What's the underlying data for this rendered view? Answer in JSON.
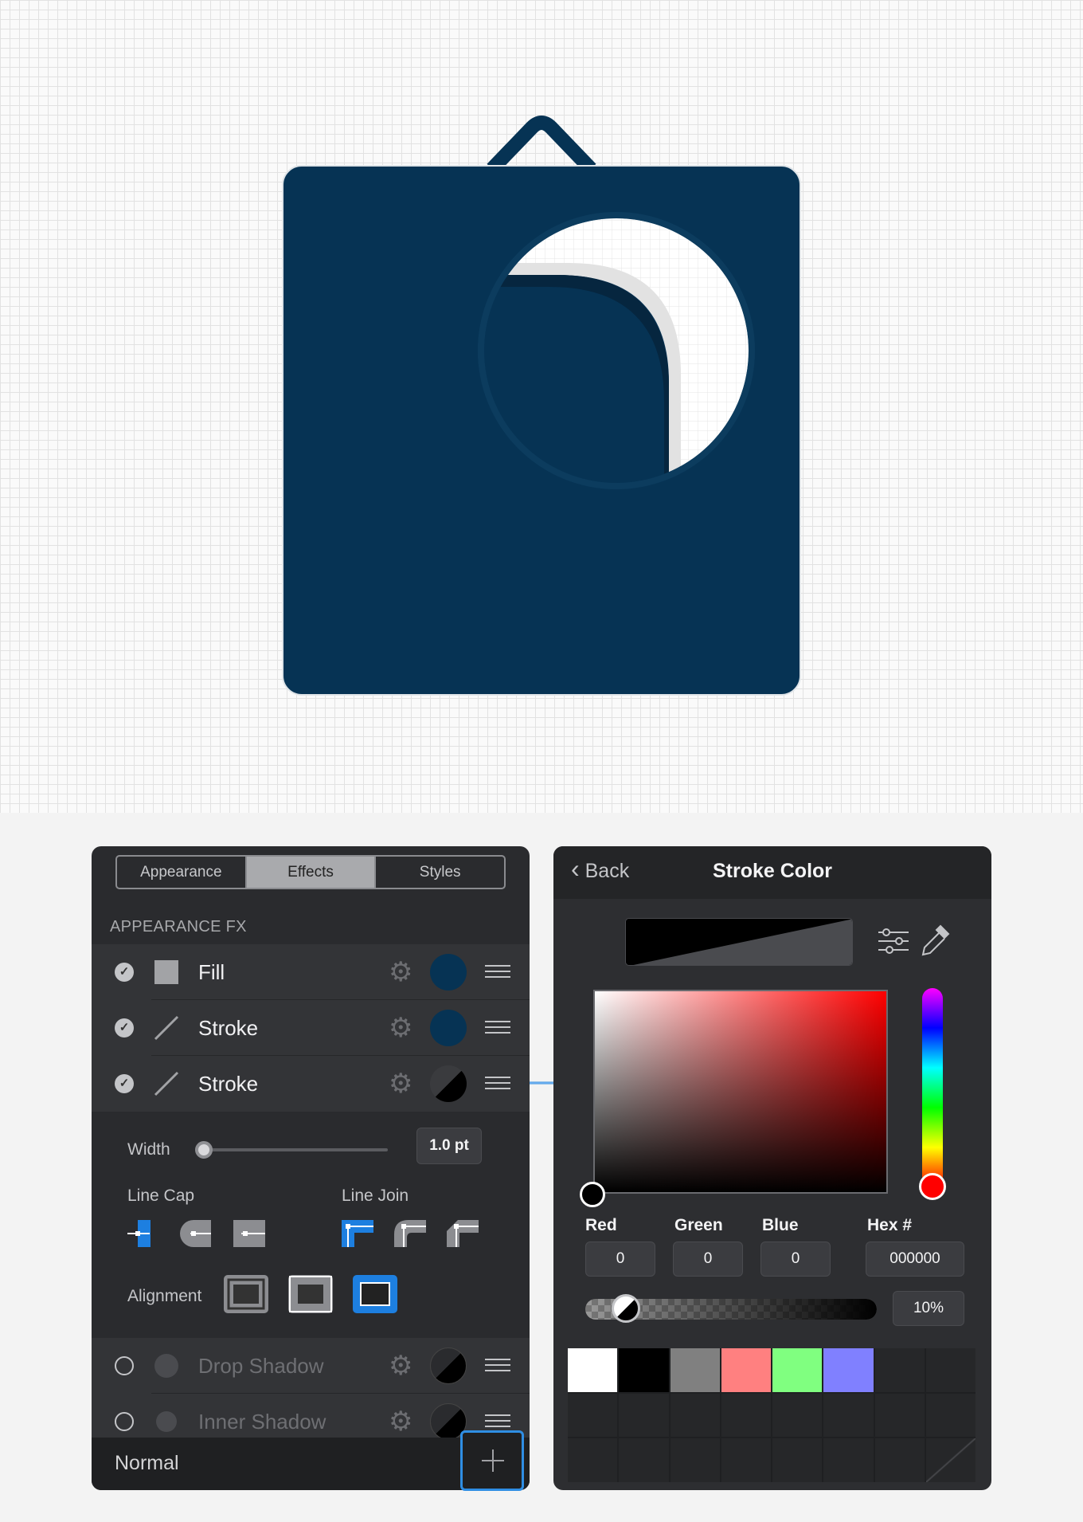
{
  "artwork": {
    "body_color": "#063354",
    "page_white": "#ffffff",
    "page_shadow": "#e5e5e5"
  },
  "panel_left": {
    "tabs": [
      {
        "label": "Appearance",
        "active": false
      },
      {
        "label": "Effects",
        "active": true
      },
      {
        "label": "Styles",
        "active": false
      }
    ],
    "section_title": "APPEARANCE FX",
    "effects": [
      {
        "label": "Fill",
        "enabled": true,
        "icon": "fill-square-icon",
        "color": "#063354"
      },
      {
        "label": "Stroke",
        "enabled": true,
        "icon": "stroke-line-icon",
        "color": "#063354"
      },
      {
        "label": "Stroke",
        "enabled": true,
        "icon": "stroke-line-icon",
        "color": "#000000"
      },
      {
        "label": "Drop Shadow",
        "enabled": false,
        "icon": "dot-icon",
        "color": "#000000"
      },
      {
        "label": "Inner Shadow",
        "enabled": false,
        "icon": "dot-icon",
        "color": "#000000"
      }
    ],
    "stroke_options": {
      "width_label": "Width",
      "width_value": "1.0 pt",
      "width_slider": 0.02,
      "line_cap_label": "Line Cap",
      "line_join_label": "Line Join",
      "alignment_label": "Alignment",
      "cap_selected": 0,
      "join_selected": 0,
      "alignment_selected": 2
    },
    "footer": {
      "blend_mode": "Normal",
      "add_icon": "plus-icon"
    }
  },
  "panel_right": {
    "back_label": "Back",
    "title": "Stroke Color",
    "channels": [
      {
        "label": "Red",
        "value": "0"
      },
      {
        "label": "Green",
        "value": "0"
      },
      {
        "label": "Blue",
        "value": "0"
      }
    ],
    "hex_label": "Hex #",
    "hex_value": "000000",
    "opacity_value": "10%",
    "opacity": 0.1,
    "hue_color": "#ff0000",
    "palette": [
      "#ffffff",
      "#000000",
      "#808080",
      "#ff8080",
      "#80ff80",
      "#8080ff"
    ]
  }
}
